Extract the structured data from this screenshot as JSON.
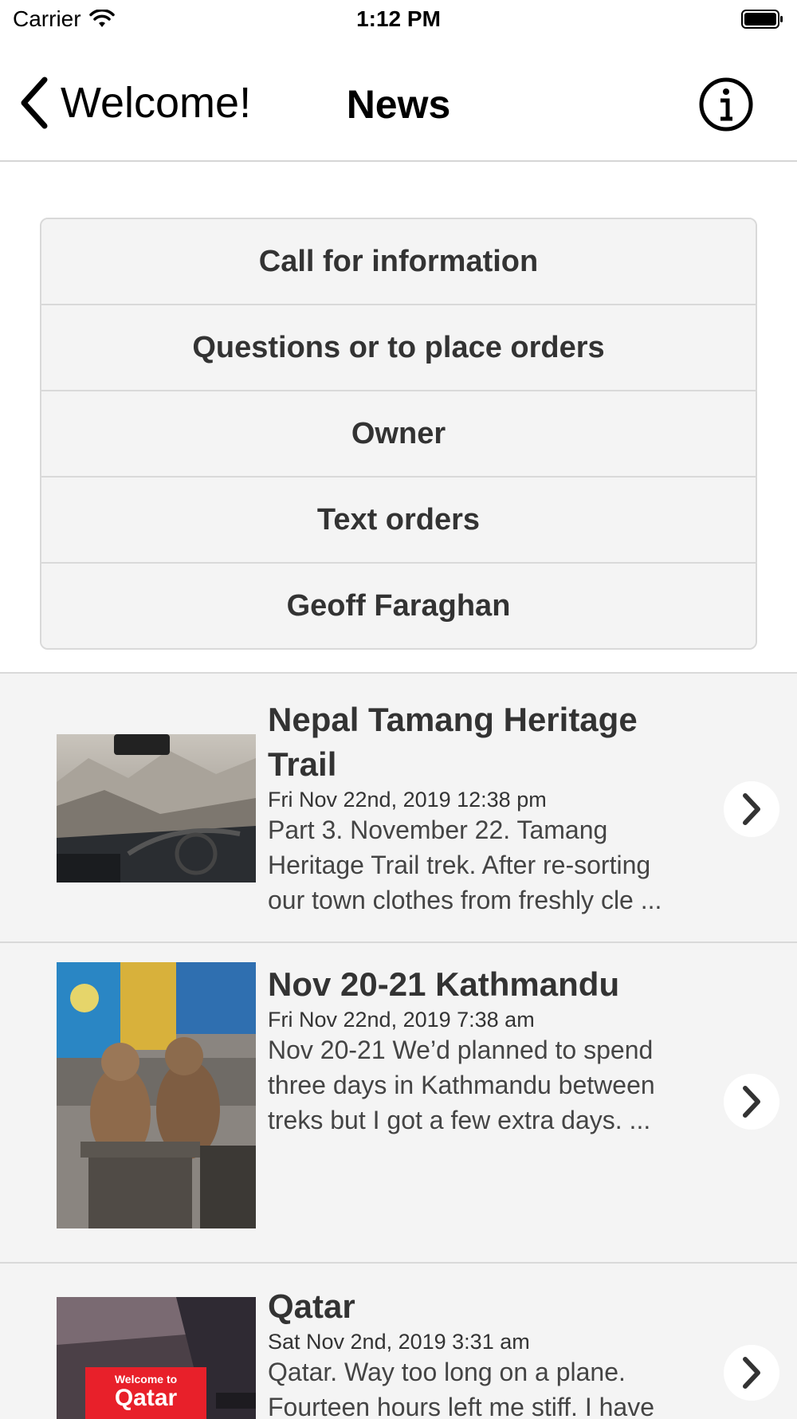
{
  "status_bar": {
    "carrier": "Carrier",
    "time": "1:12 PM"
  },
  "nav": {
    "back_label": "Welcome!",
    "title": "News",
    "info_icon": "info-circle-icon"
  },
  "contact_buttons": [
    "Call for information",
    "Questions or to place orders",
    "Owner",
    "Text orders",
    "Geoff Faraghan"
  ],
  "news": [
    {
      "title_line1": "Nepal Tamang Heritage",
      "title_line2": "Trail",
      "date": "Fri Nov 22nd, 2019 12:38 pm",
      "excerpt": [
        "Part 3. November 22. Tamang",
        "Heritage Trail trek. After re-sorting",
        "our town clothes from freshly cle ..."
      ],
      "thumb": "bus-window-mountain-photo"
    },
    {
      "title_line1": "Nov 20-21 Kathmandu",
      "date": "Fri Nov 22nd, 2019 7:38 am",
      "excerpt": [
        "Nov 20-21 We’d planned to spend",
        "three days in Kathmandu between",
        "treks but I got a few extra days. ..."
      ],
      "thumb": "monkeys-photo"
    },
    {
      "title_line1": "Qatar",
      "date": "Sat Nov 2nd, 2019 3:31 am",
      "excerpt": [
        "Qatar. Way too long on a plane.",
        "Fourteen hours left me stiff. I have"
      ],
      "thumb": "airport-sign-photo",
      "thumb_text": [
        "Welcome to",
        "Qatar"
      ]
    }
  ],
  "colors": {
    "accent_bg": "#f4f4f4",
    "divider": "#d9d9d9",
    "text": "#333333"
  }
}
